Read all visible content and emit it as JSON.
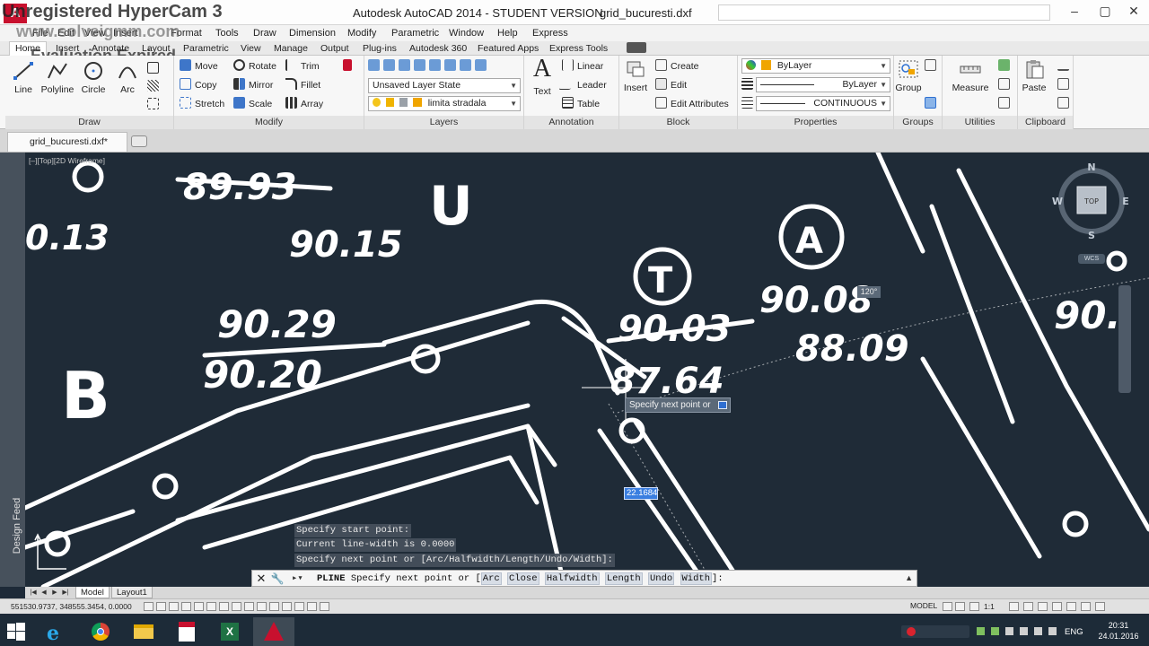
{
  "window": {
    "title": "Autodesk AutoCAD 2014 - STUDENT VERSION",
    "filename": "grid_bucuresti.dxf",
    "app_logo": "A",
    "controls": [
      "–",
      "▢",
      "✕"
    ]
  },
  "watermark": {
    "line1": "Unregistered HyperCam 3",
    "line2": "www.solveigmm.com",
    "line3": "Evaluation Expired"
  },
  "menubar": [
    "File",
    "Edit",
    "View",
    "Insert",
    "Format",
    "Tools",
    "Draw",
    "Dimension",
    "Modify",
    "Parametric",
    "Window",
    "Help",
    "Express"
  ],
  "ribbon_tabs": [
    "Home",
    "Insert",
    "Annotate",
    "Layout",
    "Parametric",
    "View",
    "Manage",
    "Output",
    "Plug-ins",
    "Autodesk 360",
    "Featured Apps",
    "Express Tools"
  ],
  "ribbon": {
    "draw": {
      "title": "Draw",
      "line": "Line",
      "polyline": "Polyline",
      "circle": "Circle",
      "arc": "Arc"
    },
    "modify": {
      "title": "Modify",
      "move": "Move",
      "rotate": "Rotate",
      "trim": "Trim",
      "copy": "Copy",
      "mirror": "Mirror",
      "fillet": "Fillet",
      "stretch": "Stretch",
      "scale": "Scale",
      "array": "Array"
    },
    "layers": {
      "title": "Layers",
      "layer_state": "Unsaved Layer State",
      "current_layer": "limita stradala"
    },
    "annotation": {
      "title": "Annotation",
      "text": "Text",
      "linear": "Linear",
      "leader": "Leader",
      "table": "Table"
    },
    "block": {
      "title": "Block",
      "insert": "Insert",
      "create": "Create",
      "edit": "Edit",
      "edit_attributes": "Edit Attributes"
    },
    "properties": {
      "title": "Properties",
      "color": "ByLayer",
      "lineweight": "ByLayer",
      "linetype": "CONTINUOUS"
    },
    "groups": {
      "title": "Groups",
      "group": "Group"
    },
    "utilities": {
      "title": "Utilities",
      "measure": "Measure"
    },
    "clipboard": {
      "title": "Clipboard",
      "paste": "Paste"
    }
  },
  "doc_tab": "grid_bucuresti.dxf*",
  "design_feed": "Design Feed",
  "viewport": {
    "label": "[–][Top][2D Wireframe]",
    "compass": {
      "n": "N",
      "s": "S",
      "e": "E",
      "w": "W",
      "top": "TOP",
      "wcs": "WCS"
    },
    "tooltip": "Specify next point or",
    "dim_value": "22.1684",
    "angle": "120°",
    "drawing_labels": [
      "89.93",
      "90.15",
      "0.13",
      "90.29",
      "90.20",
      "90.03",
      "87.64",
      "90.08",
      "88.09",
      "90.",
      "U",
      "T",
      "A",
      "B"
    ]
  },
  "command_history": [
    "Specify start point:",
    "Current line-width is 0.0000",
    "Specify next point or [Arc/Halfwidth/Length/Undo/Width]:"
  ],
  "command_line": {
    "command": "PLINE",
    "prompt": "Specify next point or [",
    "options": [
      "Arc",
      "Close",
      "Halfwidth",
      "Length",
      "Undo",
      "Width"
    ],
    "suffix": "]:"
  },
  "layout_tabs": [
    "Model",
    "Layout1"
  ],
  "status": {
    "coords": "551530.9737, 348555.3454, 0.0000",
    "model": "MODEL",
    "scale": "1:1"
  },
  "taskbar": {
    "language": "ENG",
    "time": "20:31",
    "date": "24.01.2016",
    "apps": [
      "internet-explorer",
      "chrome",
      "file-explorer",
      "acrobat",
      "excel",
      "autocad"
    ]
  },
  "colors": {
    "viewport_bg": "#1f2b37",
    "accent": "#c8102e",
    "selection": "#3a7ee0"
  }
}
